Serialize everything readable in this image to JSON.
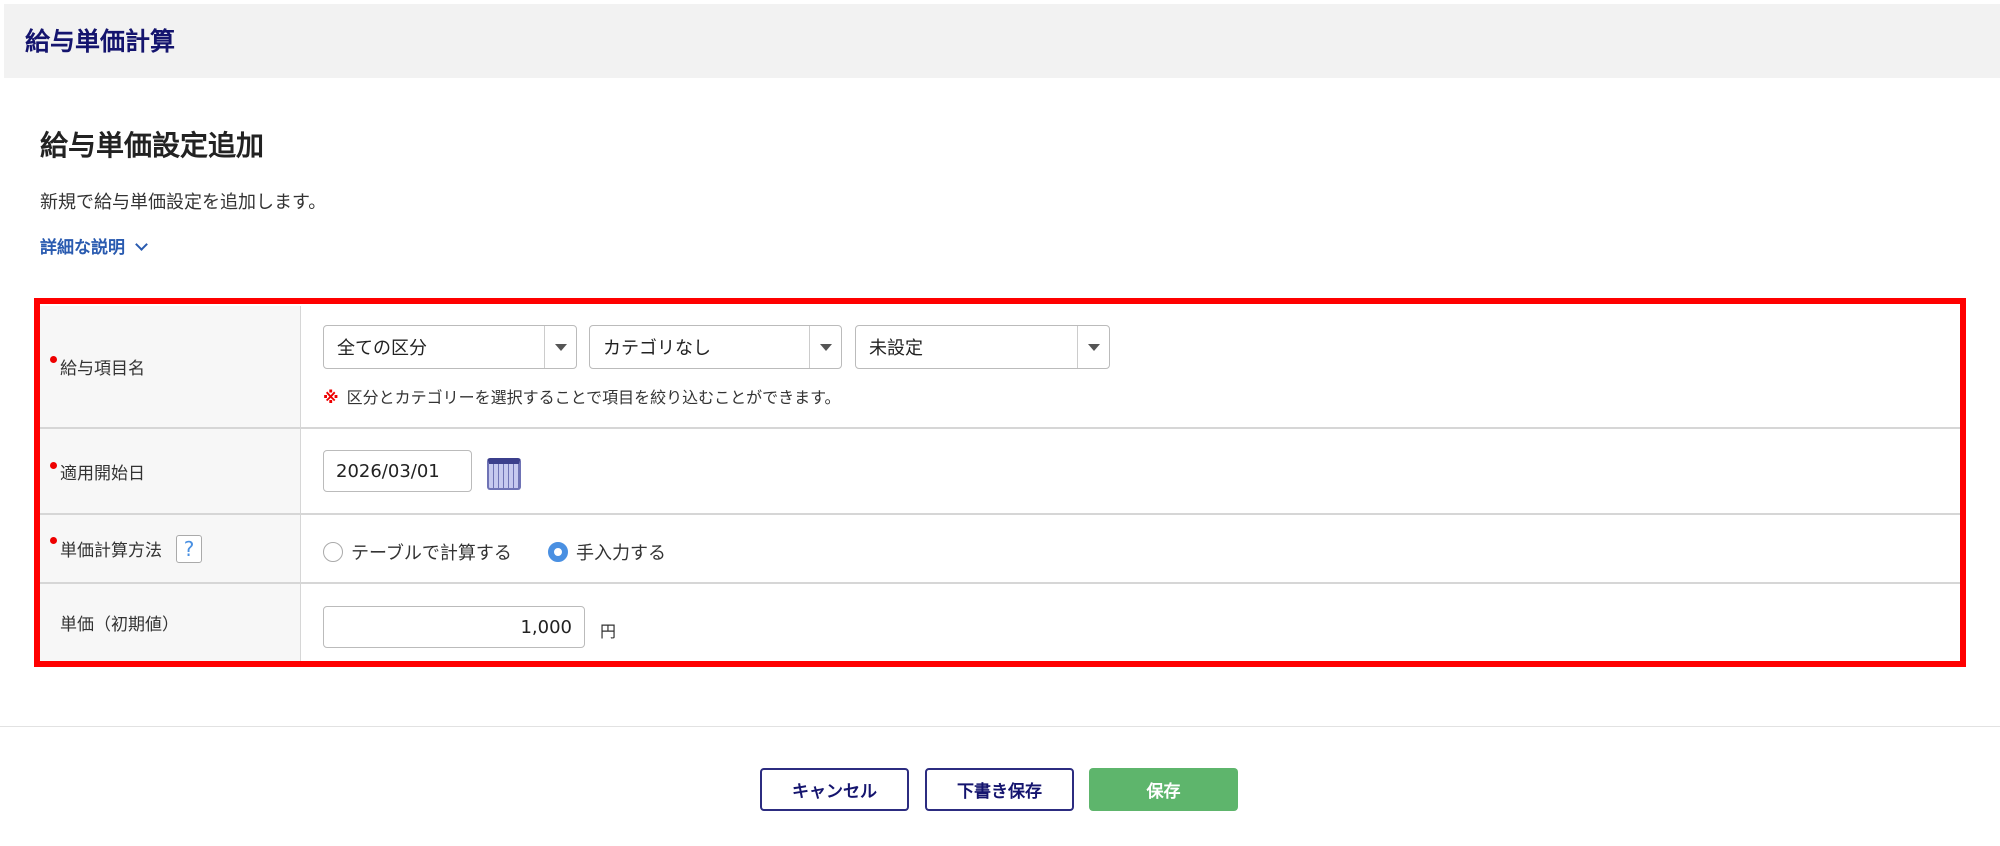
{
  "header": {
    "title": "給与単価計算"
  },
  "page": {
    "title": "給与単価設定追加",
    "description": "新規で給与単価設定を追加します。",
    "detail_link": "詳細な説明"
  },
  "form": {
    "item_name": {
      "label": "給与項目名",
      "selects": [
        "全ての区分",
        "カテゴリなし",
        "未設定"
      ],
      "note_mark": "※",
      "note": "区分とカテゴリーを選択することで項目を絞り込むことができます。"
    },
    "start_date": {
      "label": "適用開始日",
      "value": "2026/03/01"
    },
    "calc_method": {
      "label": "単価計算方法",
      "help": "?",
      "options": [
        "テーブルで計算する",
        "手入力する"
      ],
      "selected": "手入力する"
    },
    "unit_price": {
      "label": "単価（初期値）",
      "value": "1,000",
      "unit": "円"
    }
  },
  "buttons": {
    "cancel": "キャンセル",
    "draft": "下書き保存",
    "save": "保存"
  }
}
